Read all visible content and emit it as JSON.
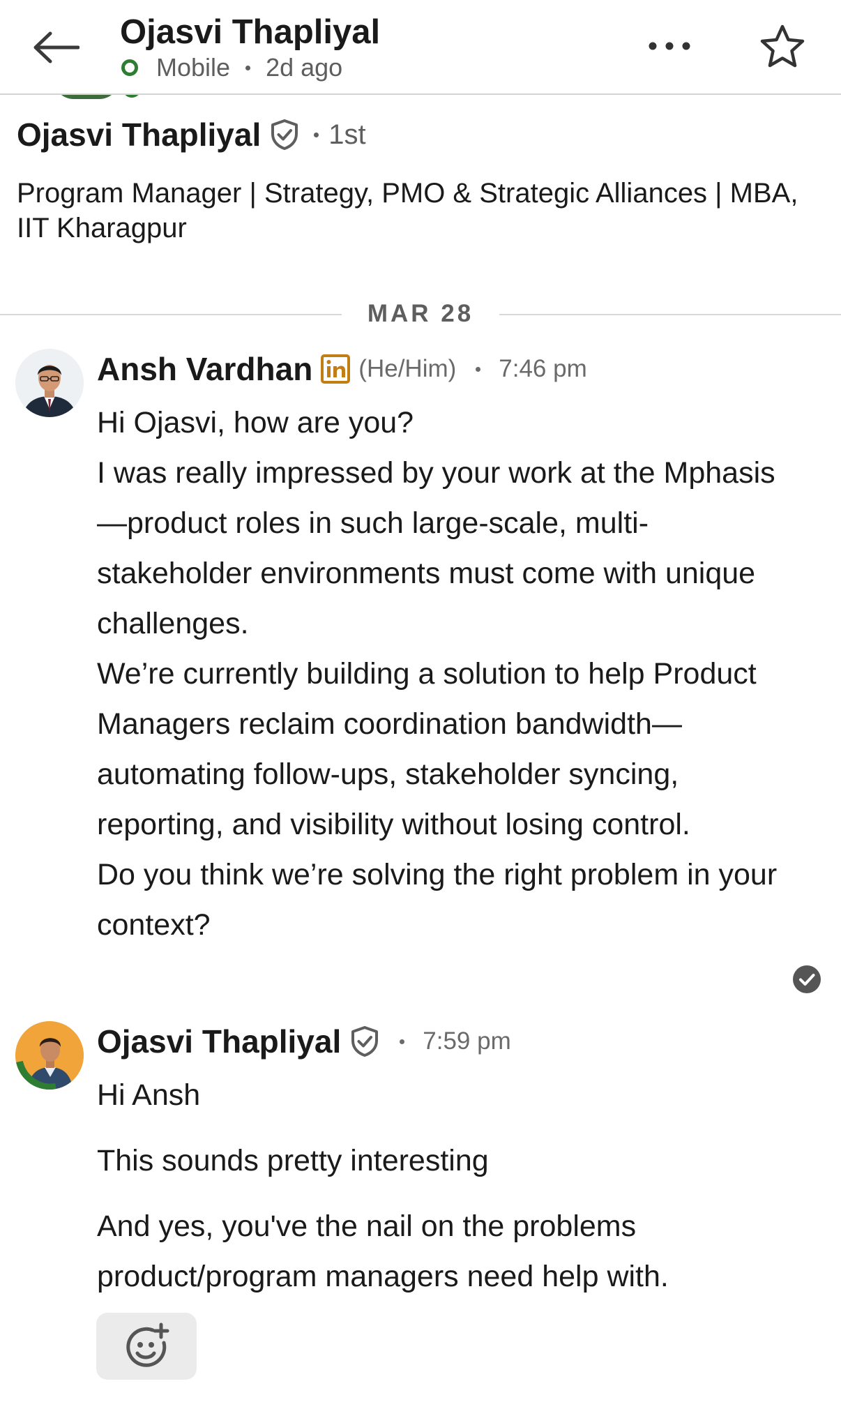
{
  "header": {
    "name": "Ojasvi Thapliyal",
    "status": "Mobile",
    "last_active": "2d ago"
  },
  "profile": {
    "name": "Ojasvi Thapliyal",
    "degree": "1st",
    "headline": "Program Manager | Strategy, PMO & Strategic Alliances | MBA, IIT Kharagpur"
  },
  "date_divider": "MAR 28",
  "messages": [
    {
      "sender": "Ansh Vardhan",
      "pronouns": "(He/Him)",
      "time": "7:46 pm",
      "lines": [
        "Hi Ojasvi, how are you?",
        "I was really impressed by your work at the Mphasis—product roles in such large-scale, multi-stakeholder environments must come with unique challenges.",
        "We’re currently building a solution to help Product Managers reclaim coordination bandwidth—automating follow-ups, stakeholder syncing, reporting, and visibility without losing control.",
        "Do you think we’re solving the right problem in your context?"
      ]
    },
    {
      "sender": "Ojasvi Thapliyal",
      "time": "7:59 pm",
      "lines": [
        "Hi Ansh",
        "This sounds pretty interesting",
        "And yes, you've the nail on the problems product/program managers need help with."
      ]
    }
  ],
  "icons": {
    "back": "arrow-left-icon",
    "more": "ellipsis-icon",
    "star": "star-icon",
    "verified": "shield-check-icon",
    "linkedin": "linkedin-icon",
    "read": "check-circle-icon",
    "react": "add-reaction-icon"
  },
  "colors": {
    "online": "#2e7d32",
    "linkedin_badge": "#c37d16",
    "text": "#1a1a1a",
    "muted": "#5e5e5e"
  }
}
